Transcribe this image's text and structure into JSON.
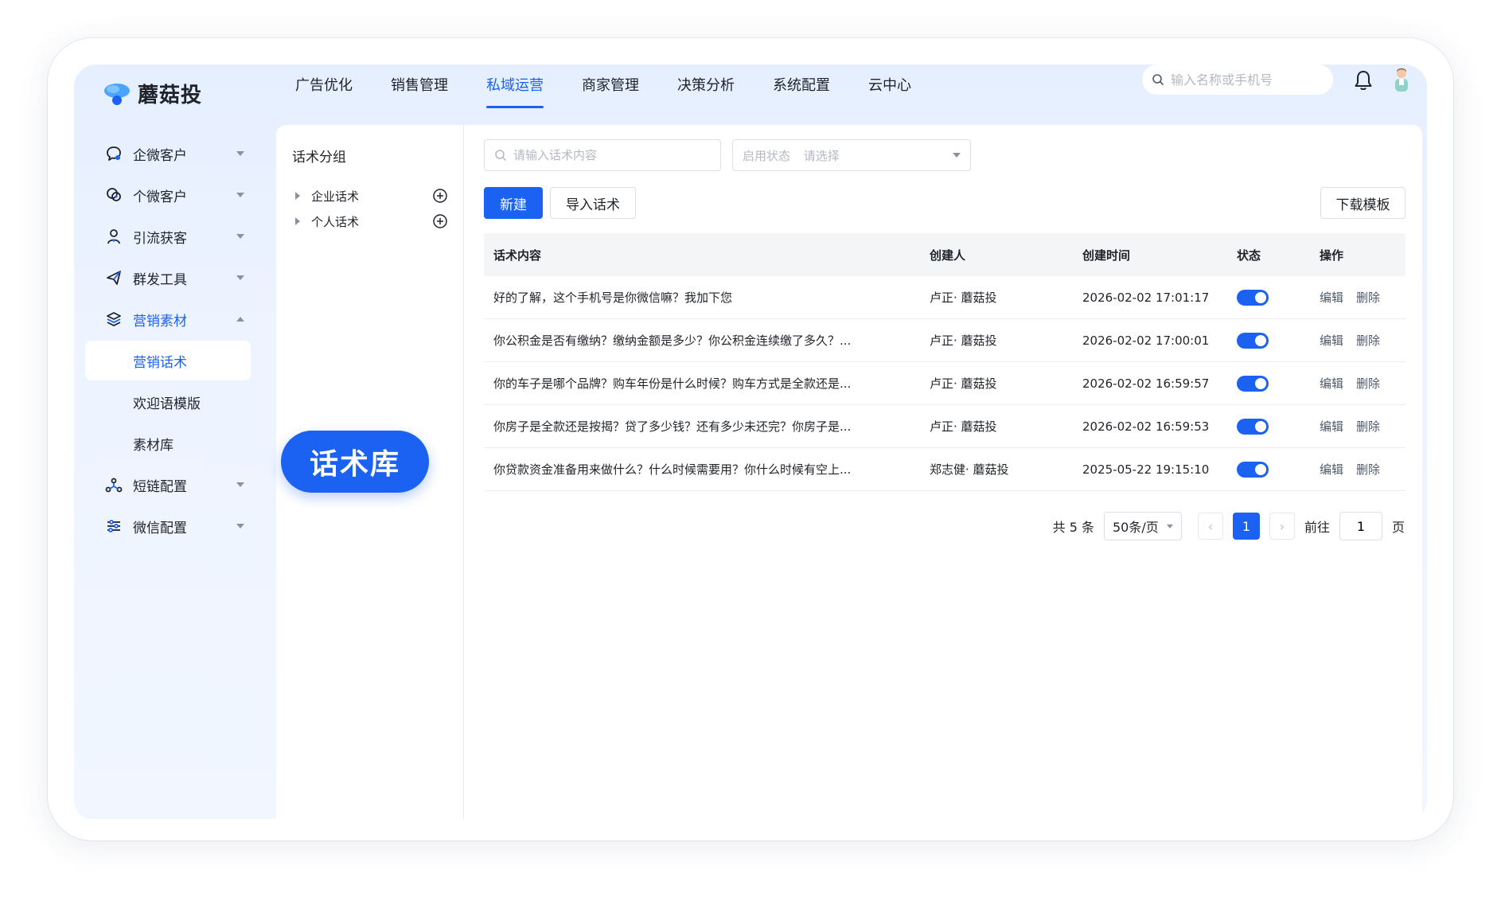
{
  "app": {
    "name": "蘑菇投"
  },
  "nav": {
    "items": [
      {
        "label": "广告优化"
      },
      {
        "label": "销售管理"
      },
      {
        "label": "私域运营",
        "active": true
      },
      {
        "label": "商家管理"
      },
      {
        "label": "决策分析"
      },
      {
        "label": "系统配置"
      },
      {
        "label": "云中心"
      }
    ],
    "search_placeholder": "输入名称或手机号",
    "accent": "#1b61f2"
  },
  "sidebar": {
    "items": [
      {
        "label": "企微客户",
        "icon": "chat-icon"
      },
      {
        "label": "个微客户",
        "icon": "wechat-icon"
      },
      {
        "label": "引流获客",
        "icon": "user-icon"
      },
      {
        "label": "群发工具",
        "icon": "send-icon"
      },
      {
        "label": "营销素材",
        "icon": "layers-icon",
        "open": true
      },
      {
        "label": "短链配置",
        "icon": "network-icon"
      },
      {
        "label": "微信配置",
        "icon": "sliders-icon"
      }
    ],
    "sub_items": [
      {
        "label": "营销话术",
        "active": true
      },
      {
        "label": "欢迎语模版"
      },
      {
        "label": "素材库"
      }
    ]
  },
  "callout": {
    "label": "话术库"
  },
  "groups": {
    "title": "话术分组",
    "items": [
      {
        "label": "企业话术"
      },
      {
        "label": "个人话术"
      }
    ]
  },
  "filters": {
    "content_placeholder": "请输入话术内容",
    "status_label": "启用状态",
    "status_placeholder": "请选择"
  },
  "buttons": {
    "new": "新建",
    "import": "导入话术",
    "download": "下载模板"
  },
  "table": {
    "headers": [
      "话术内容",
      "创建人",
      "创建时间",
      "状态",
      "操作"
    ],
    "rows": [
      {
        "content": "好的了解，这个手机号是你微信嘛？我加下您",
        "creator": "卢正· 蘑菇投",
        "time": "2026-02-02 17:01:17",
        "enabled": true
      },
      {
        "content": "你公积金是否有缴纳？缴纳金额是多少？你公积金连续缴了多久？...",
        "creator": "卢正· 蘑菇投",
        "time": "2026-02-02 17:00:01",
        "enabled": true
      },
      {
        "content": "你的车子是哪个品牌？购车年份是什么时候？购车方式是全款还是...",
        "creator": "卢正· 蘑菇投",
        "time": "2026-02-02 16:59:57",
        "enabled": true
      },
      {
        "content": "你房子是全款还是按揭？贷了多少钱？还有多少未还完？你房子是...",
        "creator": "卢正· 蘑菇投",
        "time": "2026-02-02 16:59:53",
        "enabled": true
      },
      {
        "content": "你贷款资金准备用来做什么？什么时候需要用？你什么时候有空上...",
        "creator": "郑志健· 蘑菇投",
        "time": "2025-05-22 19:15:10",
        "enabled": true
      }
    ],
    "ops": {
      "edit": "编辑",
      "delete": "删除"
    }
  },
  "pagination": {
    "total": "共 5 条",
    "page_size": "50条/页",
    "current_page": "1",
    "goto_label": "前往",
    "goto_value": "1",
    "page_suffix": "页"
  }
}
